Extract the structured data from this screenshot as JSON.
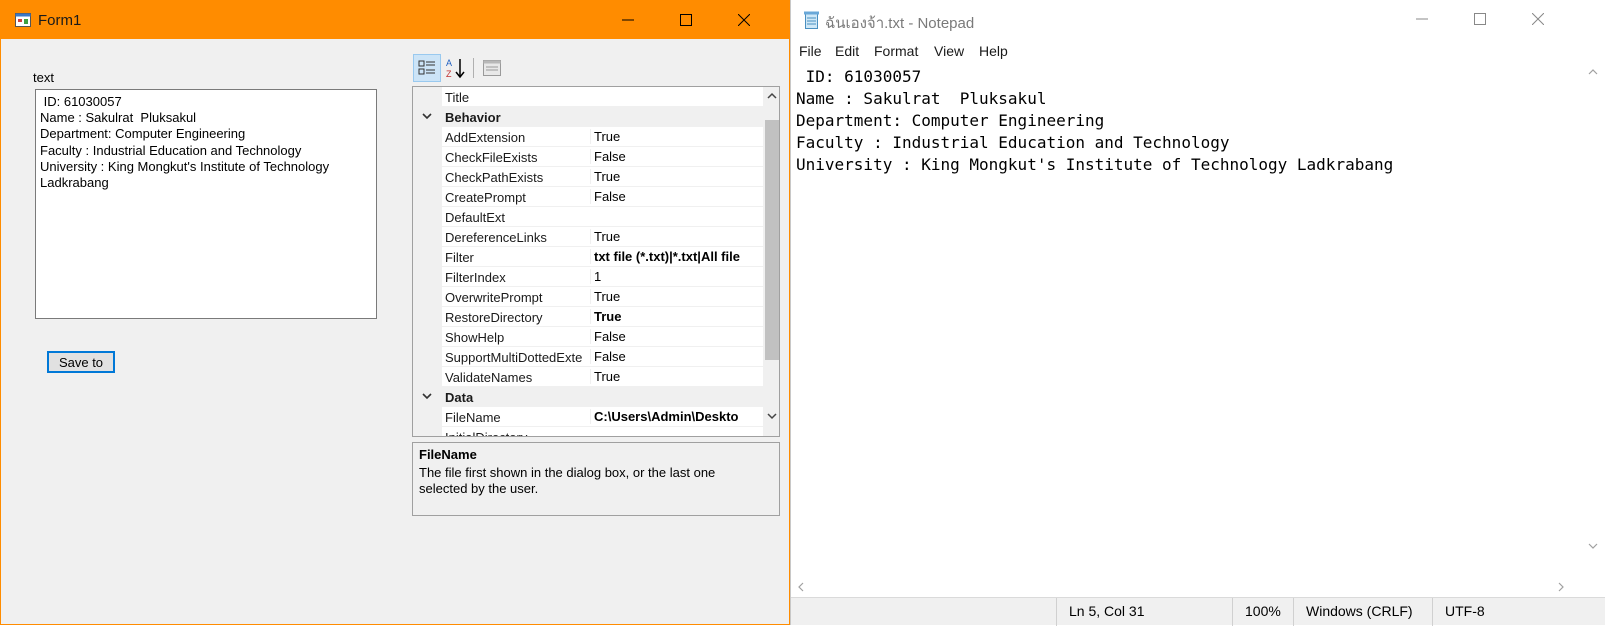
{
  "form1": {
    "title": "Form1",
    "text_label": "text",
    "textbox_value": " ID: 61030057\nName : Sakulrat  Pluksakul\nDepartment: Computer Engineering\nFaculty : Industrial Education and Technology\nUniversity : King Mongkut's Institute of Technology\nLadkrabang",
    "save_button": "Save to",
    "property_grid": {
      "rows": [
        {
          "type": "prop",
          "name": "Title",
          "value": "",
          "bold": false
        },
        {
          "type": "cat",
          "name": "Behavior"
        },
        {
          "type": "prop",
          "name": "AddExtension",
          "value": "True",
          "bold": false
        },
        {
          "type": "prop",
          "name": "CheckFileExists",
          "value": "False",
          "bold": false
        },
        {
          "type": "prop",
          "name": "CheckPathExists",
          "value": "True",
          "bold": false
        },
        {
          "type": "prop",
          "name": "CreatePrompt",
          "value": "False",
          "bold": false
        },
        {
          "type": "prop",
          "name": "DefaultExt",
          "value": "",
          "bold": false
        },
        {
          "type": "prop",
          "name": "DereferenceLinks",
          "value": "True",
          "bold": false
        },
        {
          "type": "prop",
          "name": "Filter",
          "value": "txt file (*.txt)|*.txt|All file",
          "bold": true
        },
        {
          "type": "prop",
          "name": "FilterIndex",
          "value": "1",
          "bold": false
        },
        {
          "type": "prop",
          "name": "OverwritePrompt",
          "value": "True",
          "bold": false
        },
        {
          "type": "prop",
          "name": "RestoreDirectory",
          "value": "True",
          "bold": true
        },
        {
          "type": "prop",
          "name": "ShowHelp",
          "value": "False",
          "bold": false
        },
        {
          "type": "prop",
          "name": "SupportMultiDottedExte",
          "value": "False",
          "bold": false
        },
        {
          "type": "prop",
          "name": "ValidateNames",
          "value": "True",
          "bold": false
        },
        {
          "type": "cat",
          "name": "Data"
        },
        {
          "type": "prop",
          "name": "FileName",
          "value": "C:\\Users\\Admin\\Deskto",
          "bold": true
        },
        {
          "type": "prop",
          "name": "InitialDirectory",
          "value": "",
          "bold": false
        }
      ],
      "description_title": "FileName",
      "description_text": "The file first shown in the dialog box, or the last one selected by the user."
    }
  },
  "notepad": {
    "title": "ฉันเองจ้า.txt - Notepad",
    "menu": [
      "File",
      "Edit",
      "Format",
      "View",
      "Help"
    ],
    "content": " ID: 61030057\nName : Sakulrat  Pluksakul\nDepartment: Computer Engineering\nFaculty : Industrial Education and Technology\nUniversity : King Mongkut's Institute of Technology Ladkrabang",
    "status": {
      "position": "Ln 5, Col 31",
      "zoom": "100%",
      "line_ending": "Windows (CRLF)",
      "encoding": "UTF-8"
    }
  },
  "colors": {
    "form_titlebar": "#ff8c00",
    "selection_blue": "#0078d7"
  }
}
